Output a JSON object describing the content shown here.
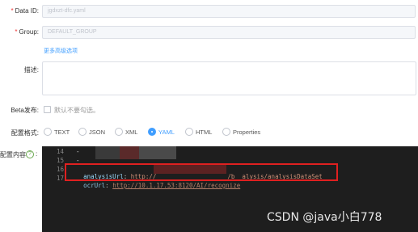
{
  "form": {
    "data_id": {
      "required_mark": "*",
      "label": "Data ID:",
      "value": "jgdxzt-dfc.yaml"
    },
    "group": {
      "required_mark": "*",
      "label": "Group:",
      "value": "DEFAULT_GROUP"
    },
    "advanced_link": "更多高级选项",
    "description_label": "描述:",
    "beta": {
      "label": "Beta发布:",
      "checkbox_label": "默认不要勾选。"
    },
    "format": {
      "label": "配置格式:",
      "options": [
        "TEXT",
        "JSON",
        "XML",
        "YAML",
        "HTML",
        "Properties"
      ],
      "selected": "YAML"
    },
    "content_label": "配置内容",
    "content_help": "?",
    "content_colon": ":"
  },
  "editor": {
    "lines": [
      {
        "num": "14",
        "text": "  -"
      },
      {
        "num": "15",
        "text": "  -"
      },
      {
        "num": "16",
        "key": "analysisUrl",
        "sep": ": ",
        "val": "http://",
        "rest": "/b  alysis/analysisDataSet"
      },
      {
        "num": "17",
        "key": "ocrUrl",
        "sep": ": ",
        "val": "http://10.1.17.53:8120/AI/recognize",
        "rest": ""
      }
    ]
  },
  "watermark": "CSDN @java小白778",
  "colors": {
    "accent": "#409eff",
    "required": "#e33333",
    "highlight": "#e02020",
    "editor_bg": "#1e1e1e"
  }
}
